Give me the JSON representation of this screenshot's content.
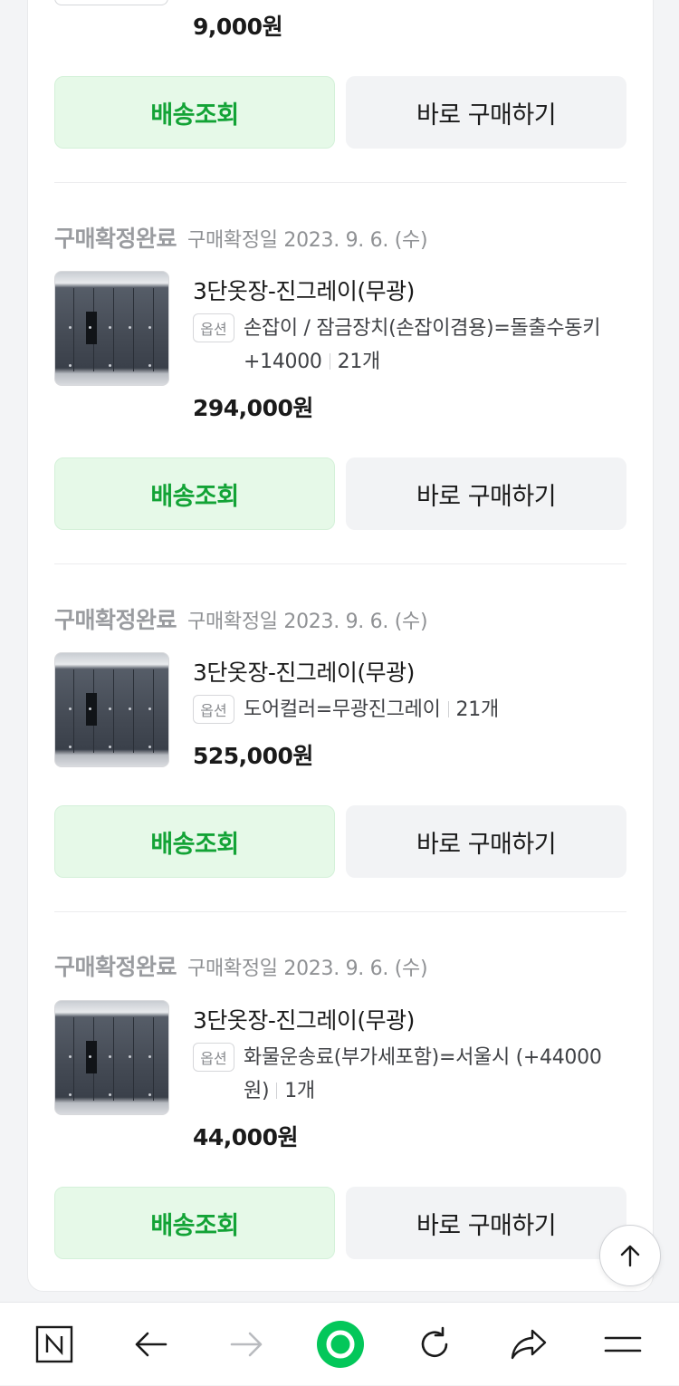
{
  "top_item": {
    "price": "9,000원"
  },
  "buttons": {
    "track_label": "배송조회",
    "buy_label": "바로 구매하기"
  },
  "orders": [
    {
      "status": "구매확정완료",
      "confirm_date": "구매확정일 2023. 9. 6. (수)",
      "title": "3단옷장-진그레이(무광)",
      "option_badge": "옵션",
      "option_text": "손잡이 / 잠금장치(손잡이겸용)=돌출수동키 +14000",
      "quantity": "21개",
      "price": "294,000원"
    },
    {
      "status": "구매확정완료",
      "confirm_date": "구매확정일 2023. 9. 6. (수)",
      "title": "3단옷장-진그레이(무광)",
      "option_badge": "옵션",
      "option_text": "도어컬러=무광진그레이",
      "quantity": "21개",
      "price": "525,000원"
    },
    {
      "status": "구매확정완료",
      "confirm_date": "구매확정일 2023. 9. 6. (수)",
      "title": "3단옷장-진그레이(무광)",
      "option_badge": "옵션",
      "option_text": "화물운송료(부가세포함)=서울시 (+44000원)",
      "quantity": "1개",
      "price": "44,000원"
    }
  ],
  "nav": {
    "icons": [
      "naver-n-icon",
      "back-arrow-icon",
      "forward-arrow-icon",
      "green-dot-home-icon",
      "refresh-icon",
      "share-icon",
      "menu-icon"
    ],
    "accent": "#03c75a"
  },
  "colors": {
    "track_bg": "#e6f9e8",
    "track_text": "#13a336",
    "buy_bg": "#f2f3f5"
  }
}
